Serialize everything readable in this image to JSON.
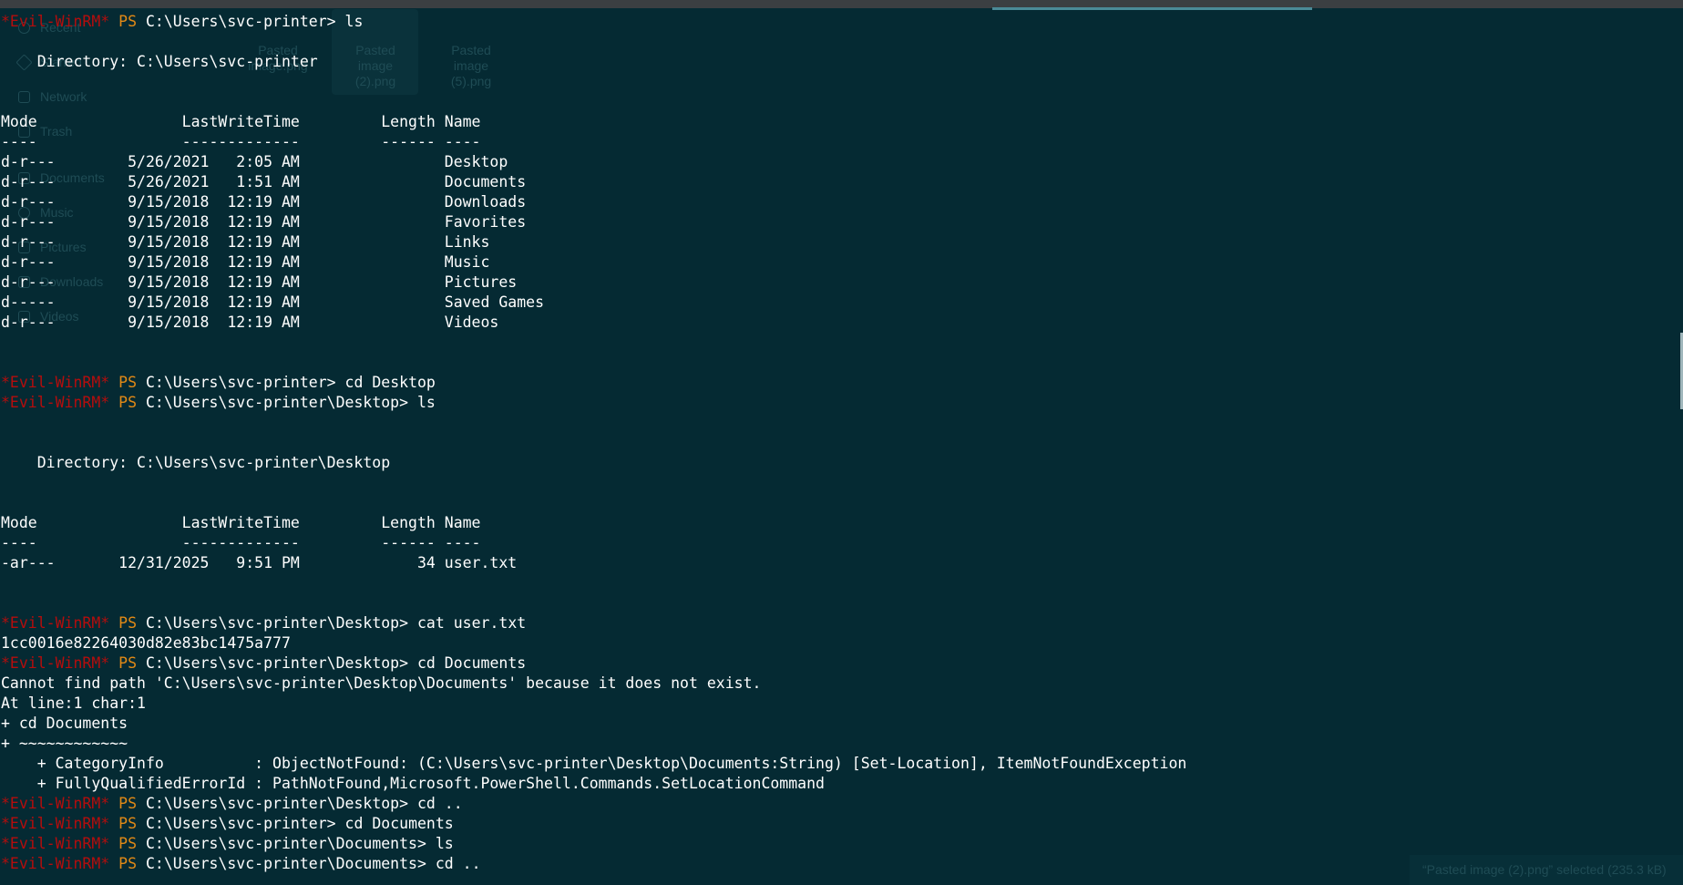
{
  "file_manager_ghost": {
    "sidebar": [
      "Recent",
      "Starred",
      "Network",
      "Trash",
      "Documents",
      "Music",
      "Pictures",
      "Downloads",
      "Videos"
    ],
    "thumbnails": [
      [
        "Pasted",
        "image.png"
      ],
      [
        "Pasted",
        "image",
        "(2).png"
      ],
      [
        "Pasted",
        "image",
        "(5).png"
      ]
    ],
    "status": "“Pasted image (2).png” selected  (235.3 kB)"
  },
  "terminal": {
    "prompt_prefix": "*Evil-WinRM*",
    "ps": "PS",
    "lines": [
      {
        "type": "prompt",
        "path": "C:\\Users\\svc-printer>",
        "cmd": " ls"
      },
      {
        "type": "text",
        "text": ""
      },
      {
        "type": "text",
        "text": "    Directory: C:\\Users\\svc-printer"
      },
      {
        "type": "text",
        "text": ""
      },
      {
        "type": "text",
        "text": ""
      },
      {
        "type": "text",
        "text": "Mode                LastWriteTime         Length Name"
      },
      {
        "type": "text",
        "text": "----                -------------         ------ ----"
      },
      {
        "type": "text",
        "text": "d-r---        5/26/2021   2:05 AM                Desktop"
      },
      {
        "type": "text",
        "text": "d-r---        5/26/2021   1:51 AM                Documents"
      },
      {
        "type": "text",
        "text": "d-r---        9/15/2018  12:19 AM                Downloads"
      },
      {
        "type": "text",
        "text": "d-r---        9/15/2018  12:19 AM                Favorites"
      },
      {
        "type": "text",
        "text": "d-r---        9/15/2018  12:19 AM                Links"
      },
      {
        "type": "text",
        "text": "d-r---        9/15/2018  12:19 AM                Music"
      },
      {
        "type": "text",
        "text": "d-r---        9/15/2018  12:19 AM                Pictures"
      },
      {
        "type": "text",
        "text": "d-----        9/15/2018  12:19 AM                Saved Games"
      },
      {
        "type": "text",
        "text": "d-r---        9/15/2018  12:19 AM                Videos"
      },
      {
        "type": "text",
        "text": ""
      },
      {
        "type": "text",
        "text": ""
      },
      {
        "type": "prompt",
        "path": "C:\\Users\\svc-printer>",
        "cmd": " cd Desktop"
      },
      {
        "type": "prompt",
        "path": "C:\\Users\\svc-printer\\Desktop>",
        "cmd": " ls"
      },
      {
        "type": "text",
        "text": ""
      },
      {
        "type": "text",
        "text": ""
      },
      {
        "type": "text",
        "text": "    Directory: C:\\Users\\svc-printer\\Desktop"
      },
      {
        "type": "text",
        "text": ""
      },
      {
        "type": "text",
        "text": ""
      },
      {
        "type": "text",
        "text": "Mode                LastWriteTime         Length Name"
      },
      {
        "type": "text",
        "text": "----                -------------         ------ ----"
      },
      {
        "type": "text",
        "text": "-ar---       12/31/2025   9:51 PM             34 user.txt"
      },
      {
        "type": "text",
        "text": ""
      },
      {
        "type": "text",
        "text": ""
      },
      {
        "type": "prompt",
        "path": "C:\\Users\\svc-printer\\Desktop>",
        "cmd": " cat user.txt"
      },
      {
        "type": "text",
        "text": "1cc0016e82264030d82e83bc1475a777"
      },
      {
        "type": "prompt",
        "path": "C:\\Users\\svc-printer\\Desktop>",
        "cmd": " cd Documents"
      },
      {
        "type": "text",
        "text": "Cannot find path 'C:\\Users\\svc-printer\\Desktop\\Documents' because it does not exist."
      },
      {
        "type": "text",
        "text": "At line:1 char:1"
      },
      {
        "type": "text",
        "text": "+ cd Documents"
      },
      {
        "type": "text",
        "text": "+ ~~~~~~~~~~~~"
      },
      {
        "type": "text",
        "text": "    + CategoryInfo          : ObjectNotFound: (C:\\Users\\svc-printer\\Desktop\\Documents:String) [Set-Location], ItemNotFoundException"
      },
      {
        "type": "text",
        "text": "    + FullyQualifiedErrorId : PathNotFound,Microsoft.PowerShell.Commands.SetLocationCommand"
      },
      {
        "type": "prompt",
        "path": "C:\\Users\\svc-printer\\Desktop>",
        "cmd": " cd .."
      },
      {
        "type": "prompt",
        "path": "C:\\Users\\svc-printer>",
        "cmd": " cd Documents"
      },
      {
        "type": "prompt",
        "path": "C:\\Users\\svc-printer\\Documents>",
        "cmd": " ls"
      },
      {
        "type": "prompt",
        "path": "C:\\Users\\svc-printer\\Documents>",
        "cmd": " cd .."
      }
    ]
  }
}
